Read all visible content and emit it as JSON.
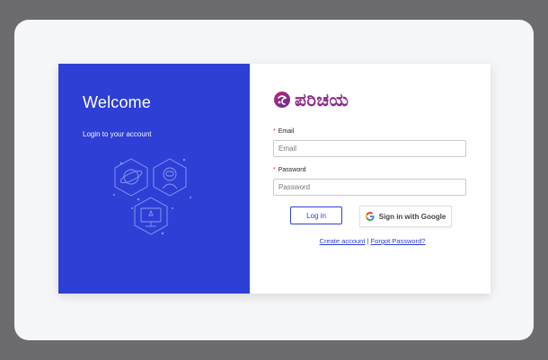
{
  "left_panel": {
    "title": "Welcome",
    "subtitle": "Login to your account",
    "background_color": "#2e3fd6"
  },
  "brand": {
    "logo_text": "ಪರಿಚಯ",
    "logo_color": "#8b2a8a",
    "icon": "logo-mark-icon"
  },
  "form": {
    "email": {
      "required_mark": "*",
      "label": "Email",
      "placeholder": "Email",
      "value": ""
    },
    "password": {
      "required_mark": "*",
      "label": "Password",
      "placeholder": "Password",
      "value": ""
    },
    "login_button": "Log in",
    "google_button": "Sign in with Google",
    "google_icon": "google-g-icon"
  },
  "links": {
    "create_account": "Create account",
    "separator": "|",
    "forgot_password": "Forgot Password?"
  }
}
